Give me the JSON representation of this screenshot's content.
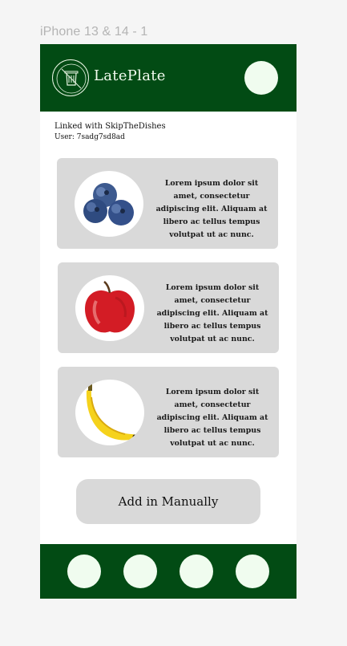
{
  "canvas": {
    "frame_label": "iPhone 13 & 14 - 1"
  },
  "header": {
    "app_name": "LatePlate",
    "logo_icon": "trash-bin-logo-icon",
    "profile_icon": "profile-avatar"
  },
  "account": {
    "linked_text": "Linked with SkipTheDishes",
    "user_text": "User: 7sadg7sd8ad"
  },
  "items": [
    {
      "image": "blueberries",
      "description": "Lorem ipsum dolor sit amet, consectetur adipiscing elit. Aliquam at libero ac tellus tempus volutpat ut ac nunc."
    },
    {
      "image": "apple",
      "description": "Lorem ipsum dolor sit amet, consectetur adipiscing elit. Aliquam at libero ac tellus tempus volutpat ut ac nunc."
    },
    {
      "image": "banana",
      "description": "Lorem ipsum dolor sit amet, consectetur adipiscing elit. Aliquam at libero ac tellus tempus volutpat ut ac nunc."
    }
  ],
  "actions": {
    "add_manual_label": "Add in Manually"
  },
  "bottom_nav": {
    "count": 4
  },
  "colors": {
    "brand_green": "#024b14",
    "accent_light": "#f0fcef",
    "card_gray": "#d9d9d9"
  }
}
